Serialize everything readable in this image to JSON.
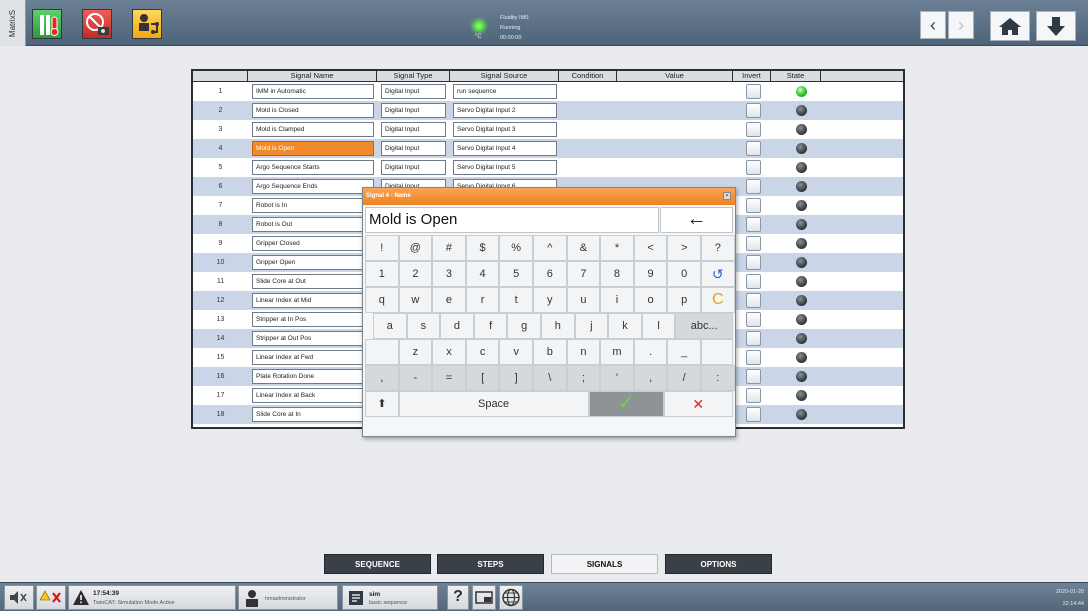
{
  "topbar": {
    "side_tab": "MatrixS",
    "status": {
      "line1": "Fluidity IMS",
      "line2": "Running",
      "line3": "00:00:00",
      "temp_unit": "°C"
    },
    "nav": {
      "back": "‹",
      "forward": "›"
    }
  },
  "table": {
    "headers": [
      "Signal Name",
      "Signal Type",
      "Signal Source",
      "Condition",
      "Value",
      "Invert",
      "State"
    ],
    "rows": [
      {
        "num": "1",
        "name": "IMM in Automatic",
        "type": "Digital Input",
        "source": "run sequence",
        "state": "on"
      },
      {
        "num": "2",
        "name": "Mold is Closed",
        "type": "Digital Input",
        "source": "Servo Digital Input 2",
        "state": "off"
      },
      {
        "num": "3",
        "name": "Mold is Clamped",
        "type": "Digital Input",
        "source": "Servo Digital Input 3",
        "state": "off"
      },
      {
        "num": "4",
        "name": "Mold is Open",
        "type": "Digital Input",
        "source": "Servo Digital Input 4",
        "state": "off",
        "selected": true
      },
      {
        "num": "5",
        "name": "Argo Sequence Starts",
        "type": "Digital Input",
        "source": "Servo Digital Input 5",
        "state": "off"
      },
      {
        "num": "6",
        "name": "Argo Sequence Ends",
        "type": "Digital Input",
        "source": "Servo Digital Input 6",
        "state": "off"
      },
      {
        "num": "7",
        "name": "Robot is In",
        "state": "off"
      },
      {
        "num": "8",
        "name": "Robot is Out",
        "state": "off"
      },
      {
        "num": "9",
        "name": "Gripper Closed",
        "state": "off"
      },
      {
        "num": "10",
        "name": "Gripper Open",
        "state": "off"
      },
      {
        "num": "11",
        "name": "Slide Core at Out",
        "state": "off"
      },
      {
        "num": "12",
        "name": "Linear Index at Mid",
        "state": "off"
      },
      {
        "num": "13",
        "name": "Stripper at In Pos",
        "state": "off"
      },
      {
        "num": "14",
        "name": "Stripper at Out Pos",
        "state": "off"
      },
      {
        "num": "15",
        "name": "Linear Index at Fwd",
        "state": "off"
      },
      {
        "num": "16",
        "name": "Plate Rotation Done",
        "state": "off"
      },
      {
        "num": "17",
        "name": "Linear Index at Back",
        "state": "off"
      },
      {
        "num": "18",
        "name": "Slide Core at In",
        "state": "off"
      }
    ]
  },
  "keyboard": {
    "title": "Signal 4 - Name",
    "value": "Mold is Open",
    "backspace": "←",
    "row1": [
      "!",
      "@",
      "#",
      "$",
      "%",
      "^",
      "&",
      "*",
      "<",
      ">",
      "?"
    ],
    "row2": [
      "1",
      "2",
      "3",
      "4",
      "5",
      "6",
      "7",
      "8",
      "9",
      "0",
      "↺"
    ],
    "row3": [
      "q",
      "w",
      "e",
      "r",
      "t",
      "y",
      "u",
      "i",
      "o",
      "p",
      "C"
    ],
    "row4": [
      "a",
      "s",
      "d",
      "f",
      "g",
      "h",
      "j",
      "k",
      "l",
      "abc..."
    ],
    "row5": [
      "z",
      "x",
      "c",
      "v",
      "b",
      "n",
      "m",
      ".",
      "_"
    ],
    "row6": [
      ",",
      "-",
      "=",
      "[",
      "]",
      "\\",
      ";",
      "'",
      ",",
      "/",
      ":"
    ],
    "shift": "⬆",
    "space": "Space",
    "ok": "✓",
    "cancel": "✕"
  },
  "tabs": [
    "SEQUENCE",
    "STEPS",
    "SIGNALS",
    "OPTIONS"
  ],
  "active_tab": "SIGNALS",
  "taskbar": {
    "alarm_time": "17:54:39",
    "alarm_text": "TwinCAT: Simulation Mode Active",
    "user": "hmiadministrator",
    "program_title": "sim",
    "program_sub": "basic sequence",
    "help": "?",
    "date": "2020-01-28",
    "time": "22:14:44"
  },
  "colors": {
    "selected": "#f08a2a",
    "row_alt": "#cad6e8",
    "title_bar": "#ee8222",
    "ok_check": "#6bd73a",
    "cancel_x": "#e12626"
  }
}
